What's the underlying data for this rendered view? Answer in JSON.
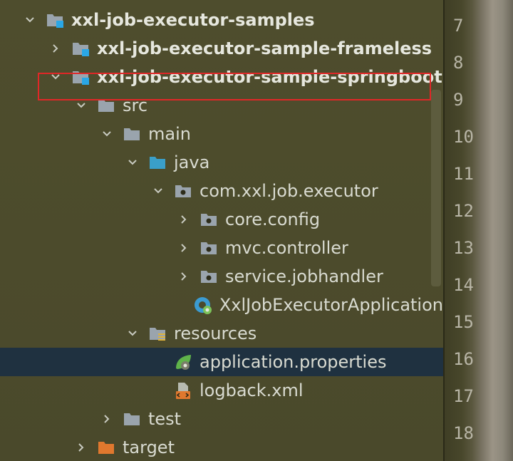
{
  "tree": {
    "items": [
      {
        "label": "xxl-job-executor-samples",
        "bold": true,
        "chevron": "down",
        "icon": "module-folder-icon",
        "indent": 0
      },
      {
        "label": "xxl-job-executor-sample-frameless",
        "bold": true,
        "chevron": "right",
        "icon": "module-folder-icon",
        "indent": 1
      },
      {
        "label": "xxl-job-executor-sample-springboot",
        "bold": true,
        "chevron": "down",
        "icon": "module-folder-icon",
        "indent": 1
      },
      {
        "label": "src",
        "bold": false,
        "chevron": "down",
        "icon": "folder-icon",
        "indent": 2
      },
      {
        "label": "main",
        "bold": false,
        "chevron": "down",
        "icon": "folder-icon",
        "indent": 3
      },
      {
        "label": "java",
        "bold": false,
        "chevron": "down",
        "icon": "source-folder-icon",
        "indent": 4
      },
      {
        "label": "com.xxl.job.executor",
        "bold": false,
        "chevron": "down",
        "icon": "package-icon",
        "indent": 5
      },
      {
        "label": "core.config",
        "bold": false,
        "chevron": "right",
        "icon": "package-icon",
        "indent": 6
      },
      {
        "label": "mvc.controller",
        "bold": false,
        "chevron": "right",
        "icon": "package-icon",
        "indent": 6
      },
      {
        "label": "service.jobhandler",
        "bold": false,
        "chevron": "right",
        "icon": "package-icon",
        "indent": 6
      },
      {
        "label": "XxlJobExecutorApplication",
        "bold": false,
        "chevron": "none",
        "icon": "spring-class-icon",
        "indent": 6
      },
      {
        "label": "resources",
        "bold": false,
        "chevron": "down",
        "icon": "resources-folder-icon",
        "indent": 4
      },
      {
        "label": "application.properties",
        "bold": false,
        "chevron": "none",
        "icon": "spring-properties-icon",
        "indent": 5,
        "selected": true
      },
      {
        "label": "logback.xml",
        "bold": false,
        "chevron": "none",
        "icon": "xml-file-icon",
        "indent": 5
      },
      {
        "label": "test",
        "bold": false,
        "chevron": "right",
        "icon": "folder-icon",
        "indent": 3
      },
      {
        "label": "target",
        "bold": false,
        "chevron": "right",
        "icon": "excluded-folder-icon",
        "indent": 2
      }
    ]
  },
  "gutter": {
    "line_numbers": [
      "7",
      "8",
      "9",
      "10",
      "11",
      "12",
      "13",
      "14",
      "15",
      "16",
      "17",
      "18"
    ]
  },
  "colors": {
    "background": "#4b4a2c",
    "selection": "#1f3140",
    "highlight_box": "#e02727",
    "folder": "#9aa4ad",
    "source_folder": "#3a9fc9",
    "excluded_folder": "#e0782e"
  }
}
